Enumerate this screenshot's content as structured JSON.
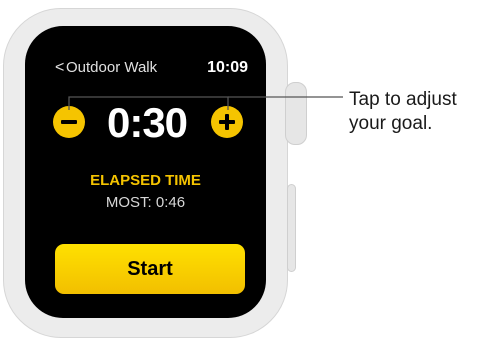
{
  "screen": {
    "back_chevron": "<",
    "app_title": "Outdoor Walk",
    "clock": "10:09",
    "goal_value": "0:30",
    "metric_label": "ELAPSED TIME",
    "best_label": "MOST: 0:46",
    "start_label": "Start",
    "minus_icon": "minus-icon",
    "plus_icon": "plus-icon"
  },
  "callout": {
    "line1": "Tap to adjust",
    "line2": "your goal."
  },
  "colors": {
    "accent_yellow": "#f5c400",
    "screen_bg": "#000000",
    "case": "#ececec"
  }
}
